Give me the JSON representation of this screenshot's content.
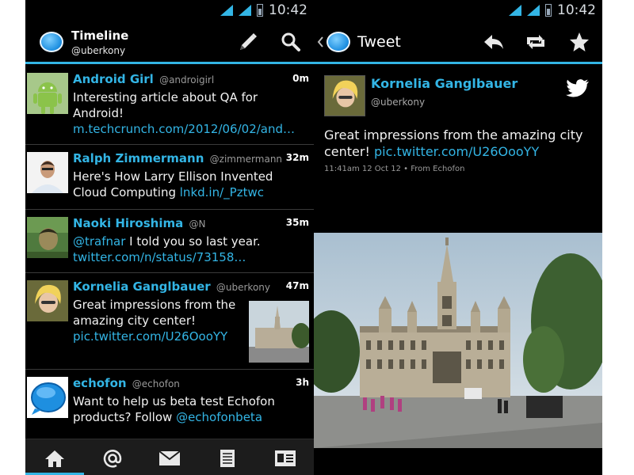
{
  "status": {
    "time": "10:42"
  },
  "timeline": {
    "header": {
      "title": "Timeline",
      "subtitle": "@uberkony"
    },
    "tweets": [
      {
        "name": "Android Girl",
        "handle": "@androigirl",
        "time": "0m",
        "text": "Interesting article about QA for Android! ",
        "link": "m.techcrunch.com/2012/06/02/and…",
        "avatar": "android-robot"
      },
      {
        "name": "Ralph Zimmermann",
        "handle": "@zimmermann",
        "time": "32m",
        "text": "Here's How Larry Ellison Invented Cloud Computing ",
        "link": "lnkd.in/_Pztwc",
        "avatar": "man-portrait"
      },
      {
        "name": "Naoki  Hiroshima",
        "handle": "@N",
        "time": "35m",
        "mention": "@trafnar",
        "text": " I told you so last year. ",
        "link": "twitter.com/n/status/73158…",
        "avatar": "man-portrait-green"
      },
      {
        "name": "Kornelia Ganglbauer",
        "handle": "@uberkony",
        "time": "47m",
        "text": "Great impressions from the amazing city center! ",
        "link": "pic.twitter.com/U26OooYY",
        "avatar": "woman-portrait"
      },
      {
        "name": "echofon",
        "handle": "@echofon",
        "time": "3h",
        "text": "Want to help us beta test Echofon products? Follow ",
        "mention": "@echofonbeta",
        "avatar": "echofon-logo"
      }
    ],
    "tabs": [
      "home-icon",
      "at-mention-icon",
      "mail-icon",
      "list-icon",
      "profile-card-icon"
    ]
  },
  "detail": {
    "header": {
      "title": "Tweet"
    },
    "author": {
      "name": "Kornelia Ganglbauer",
      "handle": "@uberkony"
    },
    "text": "Great impressions from the amazing city center! ",
    "link": "pic.twitter.com/U26OooYY",
    "meta": "11:41am 12 Oct 12 • From Echofon"
  },
  "colors": {
    "accent": "#33b5e5",
    "background": "#000000",
    "bottom_bar": "#1c1c1c"
  }
}
